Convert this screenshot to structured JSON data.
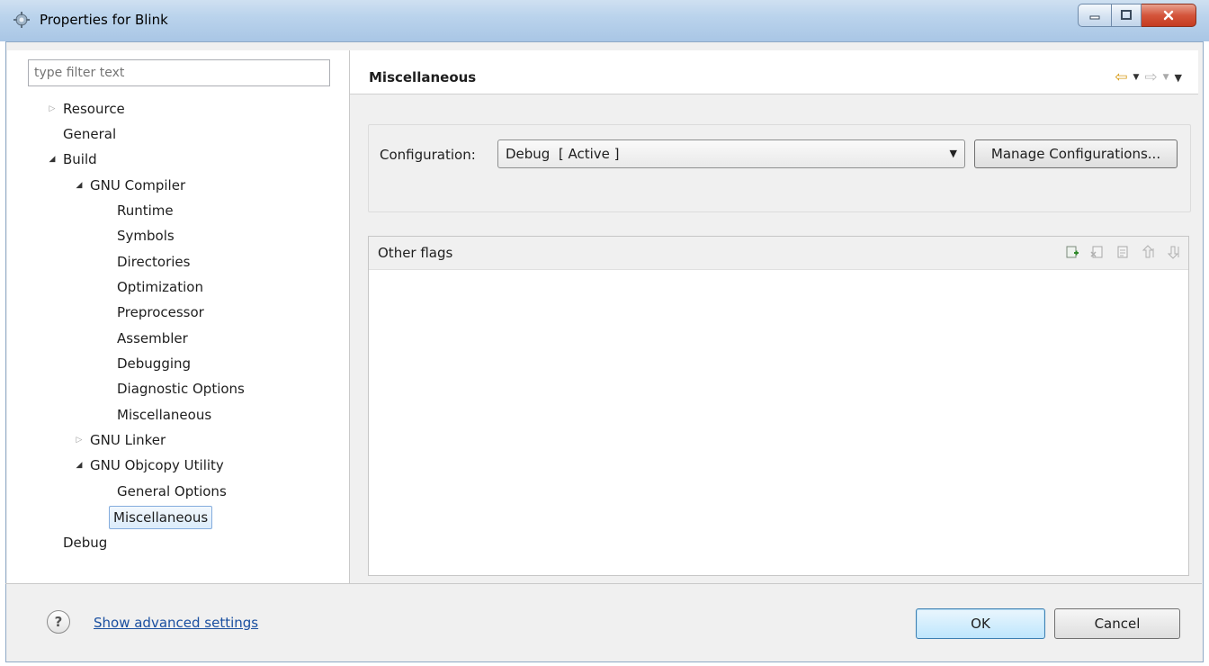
{
  "window": {
    "title": "Properties for Blink",
    "app_icon": "gear-cube-icon",
    "controls": {
      "minimize": "minimize-icon",
      "maximize": "maximize-icon",
      "close": "close-icon"
    },
    "accent": "#c53b20"
  },
  "filter": {
    "placeholder": "type filter text",
    "value": ""
  },
  "tree": [
    {
      "label": "Resource",
      "toggle": "collapsed"
    },
    {
      "label": "General",
      "toggle": "none"
    },
    {
      "label": "Build",
      "toggle": "expanded"
    },
    {
      "label": "GNU Compiler",
      "toggle": "expanded"
    },
    {
      "label": "Runtime",
      "toggle": "none"
    },
    {
      "label": "Symbols",
      "toggle": "none"
    },
    {
      "label": "Directories",
      "toggle": "none"
    },
    {
      "label": "Optimization",
      "toggle": "none"
    },
    {
      "label": "Preprocessor",
      "toggle": "none"
    },
    {
      "label": "Assembler",
      "toggle": "none"
    },
    {
      "label": "Debugging",
      "toggle": "none"
    },
    {
      "label": "Diagnostic Options",
      "toggle": "none"
    },
    {
      "label": "Miscellaneous",
      "toggle": "none"
    },
    {
      "label": "GNU Linker",
      "toggle": "collapsed"
    },
    {
      "label": "GNU Objcopy Utility",
      "toggle": "expanded"
    },
    {
      "label": "General Options",
      "toggle": "none"
    },
    {
      "label": "Miscellaneous",
      "toggle": "none",
      "selected": true
    },
    {
      "label": "Debug",
      "toggle": "none"
    }
  ],
  "page": {
    "title": "Miscellaneous",
    "nav": {
      "back_icon": "back-arrow-icon",
      "forward_icon": "forward-arrow-icon",
      "menu_icon": "view-menu-icon"
    }
  },
  "configuration": {
    "label": "Configuration:",
    "selected": "Debug  [ Active ]",
    "manage_label": "Manage Configurations..."
  },
  "other_flags": {
    "title": "Other flags",
    "tools": [
      "add-icon",
      "delete-icon",
      "edit-icon",
      "move-up-icon",
      "move-down-icon"
    ]
  },
  "footer": {
    "help_icon": "help-icon",
    "help_symbol": "?",
    "advanced_link": "Show advanced settings",
    "ok_label": "OK",
    "cancel_label": "Cancel"
  }
}
